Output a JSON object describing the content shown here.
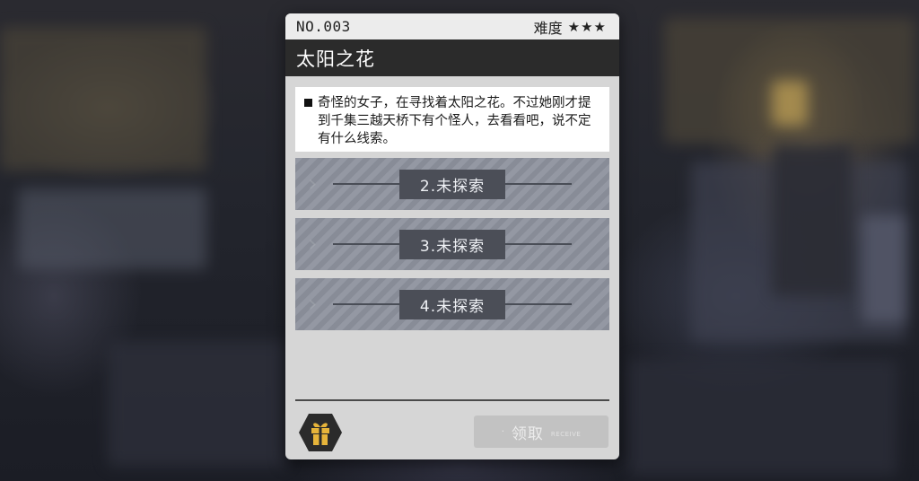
{
  "mission": {
    "number": "NO.003",
    "difficulty_label": "难度",
    "difficulty_stars": "★★★",
    "title": "太阳之花",
    "description": "奇怪的女子，在寻找着太阳之花。不过她刚才提到千集三越天桥下有个怪人，去看看吧，说不定有什么线索。"
  },
  "entries": [
    {
      "label": "2.未探索"
    },
    {
      "label": "3.未探索"
    },
    {
      "label": "4.未探索"
    }
  ],
  "footer": {
    "reward_icon": "gift-icon",
    "claim_label": "领取",
    "claim_sub": "RECEIVE",
    "claim_dot": "·"
  },
  "colors": {
    "card_bg": "#d6d6d6",
    "title_bar": "#2b2b2b",
    "entry_bg": "#8d929d",
    "gift_badge": "#2b2b2b",
    "gift_accent": "#e6b43a",
    "claim_disabled": "#c2c2c2"
  }
}
